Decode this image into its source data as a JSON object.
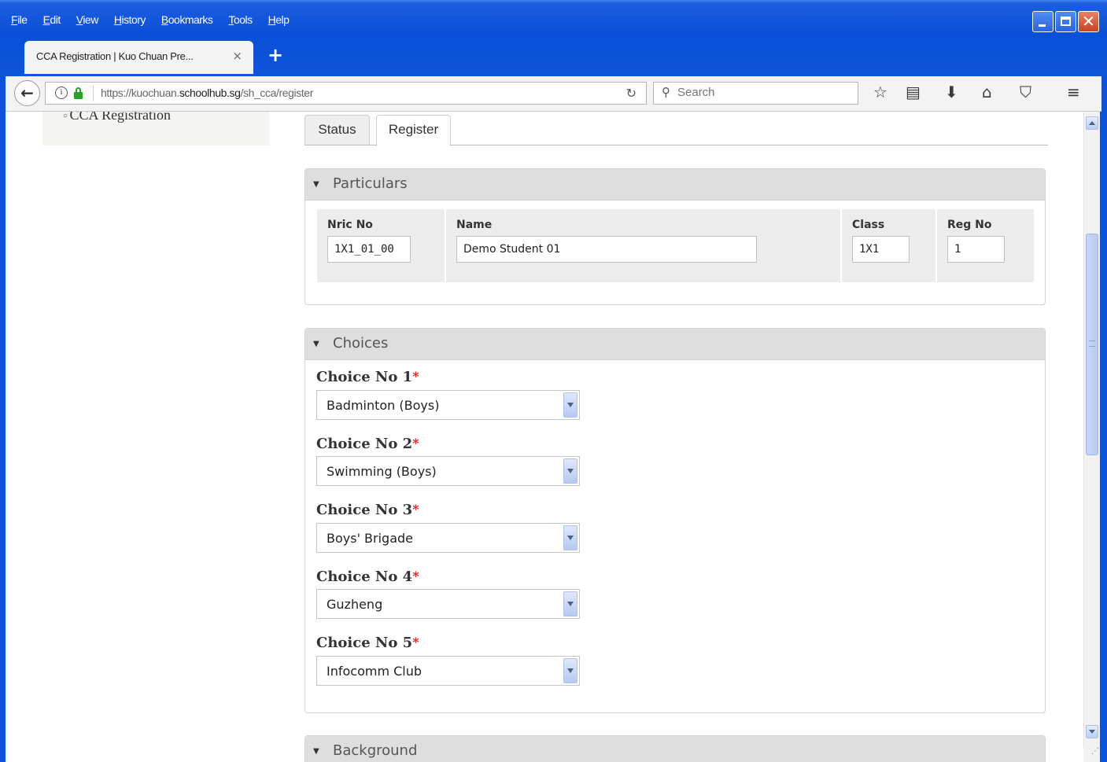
{
  "browser": {
    "menu": [
      "File",
      "Edit",
      "View",
      "History",
      "Bookmarks",
      "Tools",
      "Help"
    ],
    "tab_title": "CCA Registration | Kuo Chuan Pre...",
    "tab_close": "×",
    "new_tab": "+",
    "url_prefix": "https://kuochuan.",
    "url_domain": "schoolhub.sg",
    "url_path": "/sh_cca/register",
    "search_placeholder": "Search",
    "icons": [
      "back-arrow-icon",
      "info-icon",
      "lock-icon",
      "reload-icon",
      "search-icon",
      "bookmark-star-icon",
      "reading-list-icon",
      "download-icon",
      "home-icon",
      "pocket-icon",
      "hamburger-menu-icon"
    ]
  },
  "sidebar": {
    "item": "CCA Registration"
  },
  "page_tabs": {
    "status": "Status",
    "register": "Register"
  },
  "particulars": {
    "title": "Particulars",
    "nric_label": "Nric No",
    "nric_value": "1X1_01_00",
    "name_label": "Name",
    "name_value": "Demo Student 01",
    "class_label": "Class",
    "class_value": "1X1",
    "regno_label": "Reg No",
    "regno_value": "1"
  },
  "choices": {
    "title": "Choices",
    "required_mark": "*",
    "items": [
      {
        "label": "Choice No 1",
        "value": "Badminton (Boys)"
      },
      {
        "label": "Choice No 2",
        "value": "Swimming (Boys)"
      },
      {
        "label": "Choice No 3",
        "value": "Boys' Brigade"
      },
      {
        "label": "Choice No 4",
        "value": "Guzheng"
      },
      {
        "label": "Choice No 5",
        "value": "Infocomm Club"
      }
    ]
  },
  "background": {
    "title": "Background"
  },
  "colors": {
    "titlebar": "#0a4fd8",
    "panel_header": "#dedede",
    "required": "#dd2222"
  }
}
